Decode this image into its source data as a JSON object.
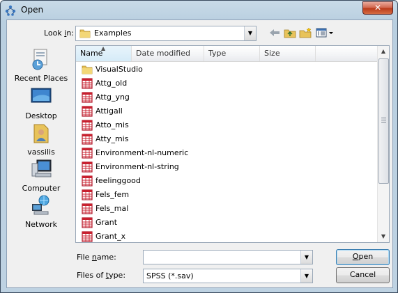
{
  "window": {
    "title": "Open",
    "close_label": "✕"
  },
  "lookin": {
    "label_prefix": "Look ",
    "label_u": "i",
    "label_suffix": "n:",
    "value": "Examples"
  },
  "places": [
    {
      "label": "Recent Places"
    },
    {
      "label": "Desktop"
    },
    {
      "label": "vassilis"
    },
    {
      "label": "Computer"
    },
    {
      "label": "Network"
    }
  ],
  "columns": [
    {
      "label": "Name"
    },
    {
      "label": "Date modified"
    },
    {
      "label": "Type"
    },
    {
      "label": "Size"
    }
  ],
  "files": [
    {
      "name": "VisualStudio",
      "icon": "folder-icon"
    },
    {
      "name": "Attg_old",
      "icon": "data-file-icon"
    },
    {
      "name": "Attg_yng",
      "icon": "data-file-icon"
    },
    {
      "name": "Attigall",
      "icon": "data-file-icon"
    },
    {
      "name": "Atto_mis",
      "icon": "data-file-icon"
    },
    {
      "name": "Atty_mis",
      "icon": "data-file-icon"
    },
    {
      "name": "Environment-nl-numeric",
      "icon": "data-file-icon"
    },
    {
      "name": "Environment-nl-string",
      "icon": "data-file-icon"
    },
    {
      "name": "feelinggood",
      "icon": "data-file-icon"
    },
    {
      "name": "Fels_fem",
      "icon": "data-file-icon"
    },
    {
      "name": "Fels_mal",
      "icon": "data-file-icon"
    },
    {
      "name": "Grant",
      "icon": "data-file-icon"
    },
    {
      "name": "Grant_x",
      "icon": "data-file-icon"
    }
  ],
  "filename": {
    "label_prefix": "File ",
    "label_u": "n",
    "label_suffix": "ame:",
    "value": ""
  },
  "filetype": {
    "label_prefix": "Files of ",
    "label_u": "t",
    "label_suffix": "ype:",
    "value": "SPSS (*.sav)"
  },
  "buttons": {
    "open_u": "O",
    "open_rest": "pen",
    "cancel": "Cancel"
  }
}
